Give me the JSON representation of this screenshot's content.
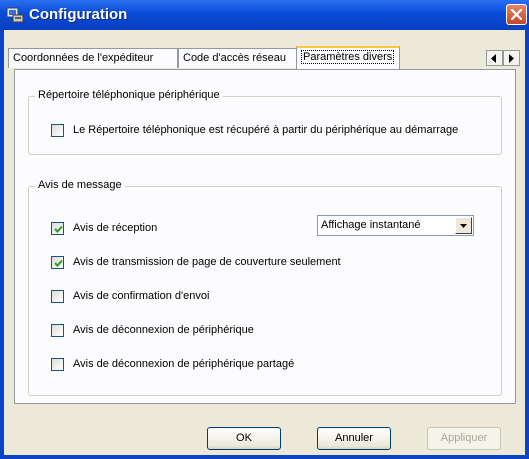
{
  "window": {
    "title": "Configuration"
  },
  "tabs": [
    {
      "label": "Coordonnées de l'expéditeur"
    },
    {
      "label": "Code d'accès réseau"
    },
    {
      "label": "Paramètres divers"
    }
  ],
  "active_tab": "Paramètres divers",
  "phonebook_group": {
    "title": "Répertoire téléphonique périphérique",
    "option": {
      "label": "Le Répertoire téléphonique est récupéré à partir du périphérique au démarrage",
      "checked": false
    }
  },
  "message_group": {
    "title": "Avis de message",
    "options": [
      {
        "label": "Avis de réception",
        "checked": true
      },
      {
        "label": "Avis de transmission de page de couverture seulement",
        "checked": true
      },
      {
        "label": "Avis de confirmation d'envoi",
        "checked": false
      },
      {
        "label": "Avis de déconnexion de périphérique",
        "checked": false
      },
      {
        "label": "Avis de déconnexion de périphérique partagé",
        "checked": false
      }
    ],
    "display_select": {
      "value": "Affichage instantané"
    }
  },
  "buttons": {
    "ok": "OK",
    "cancel": "Annuler",
    "apply": "Appliquer"
  },
  "colors": {
    "titlebar": "#0a4ad6",
    "dialog_bg": "#ece9d8",
    "panel_bg": "#fcfcfe",
    "active_tab_accent": "#ffc83c",
    "close_button": "#c8442a"
  }
}
